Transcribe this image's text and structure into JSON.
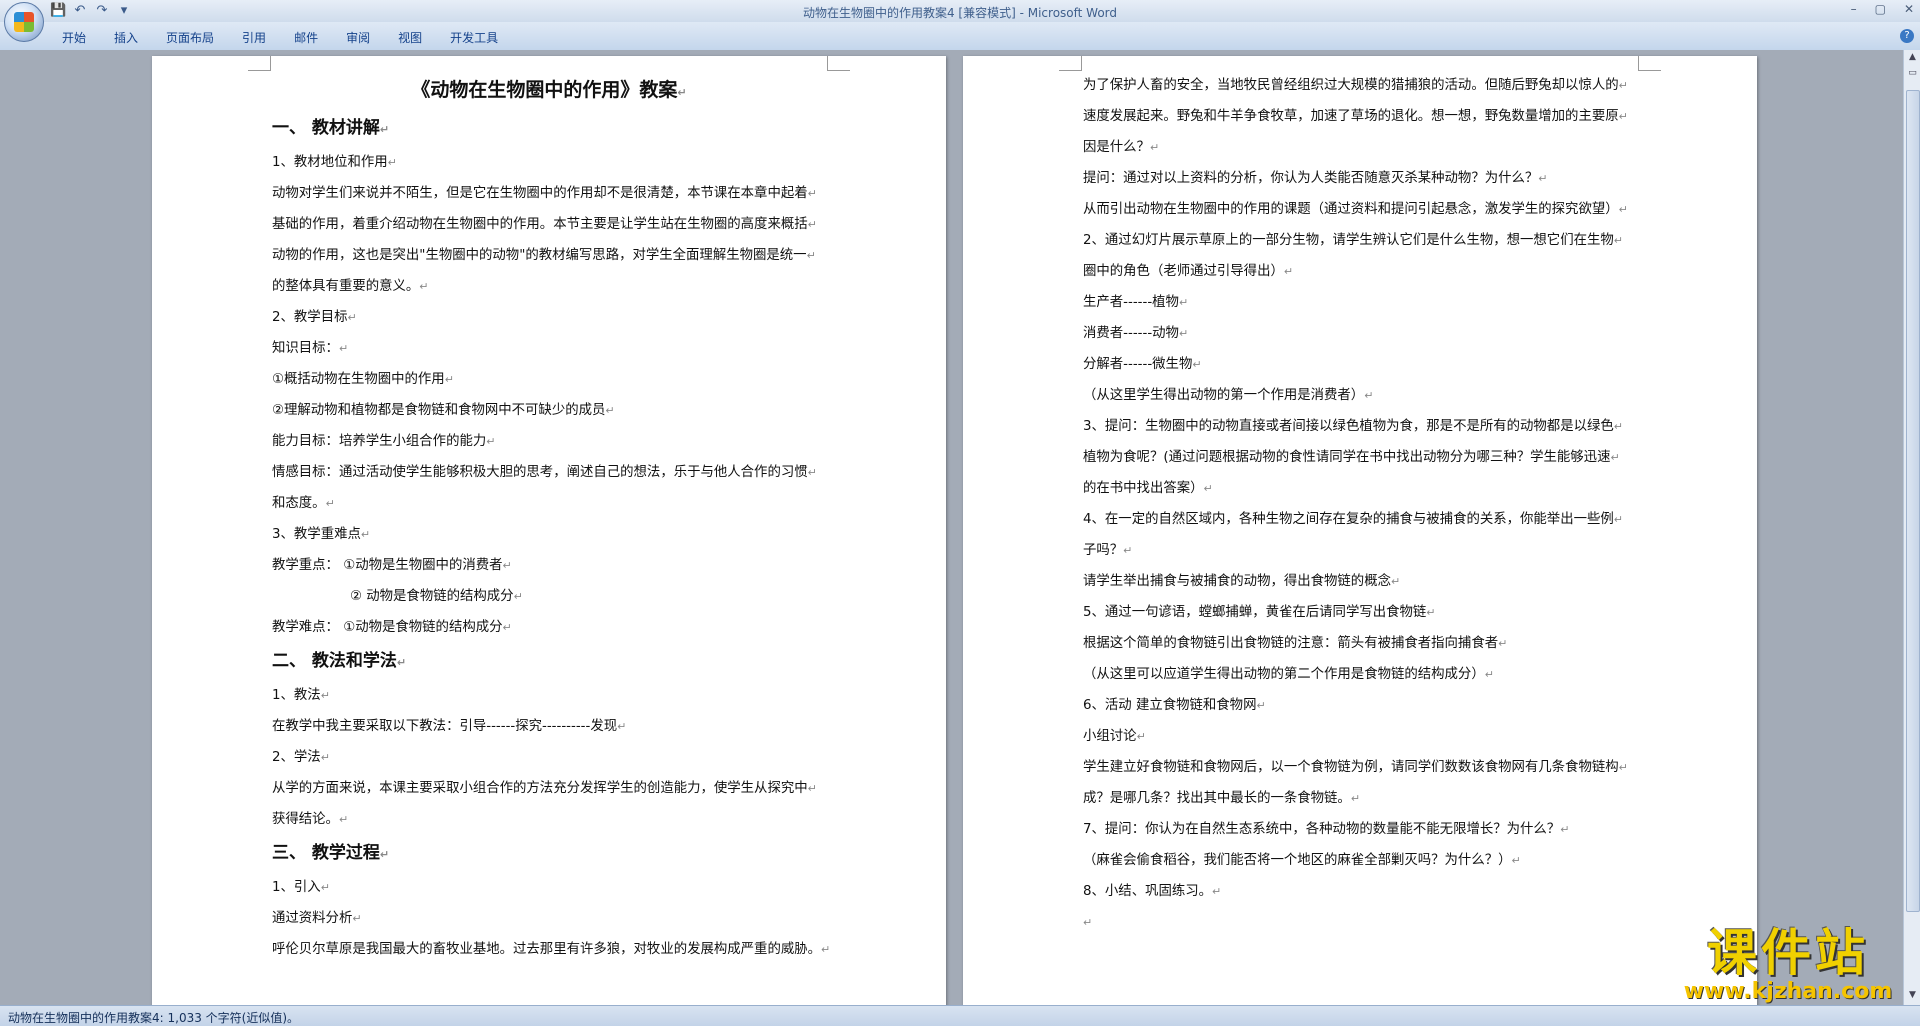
{
  "window": {
    "title": "动物在生物圈中的作用教案4 [兼容模式] - Microsoft Word",
    "controls": [
      "–",
      "▢",
      "✕"
    ]
  },
  "quick_access": {
    "icons": [
      "save-icon",
      "undo-icon",
      "redo-icon",
      "customize-icon"
    ],
    "glyphs": [
      "💾",
      "↶",
      "↷",
      "▾"
    ]
  },
  "ribbon": {
    "tabs": [
      "开始",
      "插入",
      "页面布局",
      "引用",
      "邮件",
      "审阅",
      "视图",
      "开发工具"
    ],
    "help": "?"
  },
  "page1": {
    "lines": [
      {
        "text": "《动物在生物圈中的作用》教案",
        "style": "h1"
      },
      {
        "text": "一、    教材讲解",
        "style": "h2"
      },
      {
        "text": "1、教材地位和作用",
        "style": ""
      },
      {
        "text": "动物对学生们来说并不陌生，但是它在生物圈中的作用却不是很清楚，本节课在本章中起着",
        "style": ""
      },
      {
        "text": "基础的作用，着重介绍动物在生物圈中的作用。本节主要是让学生站在生物圈的高度来概括",
        "style": ""
      },
      {
        "text": "动物的作用，这也是突出\"生物圈中的动物\"的教材编写思路，对学生全面理解生物圈是统一",
        "style": ""
      },
      {
        "text": "的整体具有重要的意义。",
        "style": ""
      },
      {
        "text": "2、教学目标",
        "style": ""
      },
      {
        "text": "知识目标：",
        "style": ""
      },
      {
        "text": "①概括动物在生物圈中的作用",
        "style": ""
      },
      {
        "text": "②理解动物和植物都是食物链和食物网中不可缺少的成员",
        "style": ""
      },
      {
        "text": "能力目标：培养学生小组合作的能力",
        "style": ""
      },
      {
        "text": "情感目标：通过活动使学生能够积极大胆的思考，阐述自己的想法，乐于与他人合作的习惯",
        "style": ""
      },
      {
        "text": "和态度。",
        "style": ""
      },
      {
        "text": "3、教学重难点",
        "style": ""
      },
      {
        "text": "教学重点：  ①动物是生物圈中的消费者",
        "style": ""
      },
      {
        "text": "② 动物是食物链的结构成分",
        "style": "ind"
      },
      {
        "text": "教学难点：  ①动物是食物链的结构成分",
        "style": ""
      },
      {
        "text": "二、    教法和学法",
        "style": "h2"
      },
      {
        "text": "1、教法",
        "style": ""
      },
      {
        "text": "在教学中我主要采取以下教法：引导------探究----------发现",
        "style": ""
      },
      {
        "text": "2、学法",
        "style": ""
      },
      {
        "text": "从学的方面来说，本课主要采取小组合作的方法充分发挥学生的创造能力，使学生从探究中",
        "style": ""
      },
      {
        "text": "获得结论。",
        "style": ""
      },
      {
        "text": "三、    教学过程",
        "style": "h2"
      },
      {
        "text": "1、引入",
        "style": ""
      },
      {
        "text": "通过资料分析",
        "style": ""
      },
      {
        "text": "呼伦贝尔草原是我国最大的畜牧业基地。过去那里有许多狼，对牧业的发展构成严重的威胁。",
        "style": ""
      }
    ]
  },
  "page2": {
    "lines": [
      {
        "text": "为了保护人畜的安全，当地牧民曾经组织过大规模的猎捕狼的活动。但随后野兔却以惊人的",
        "style": ""
      },
      {
        "text": "速度发展起来。野兔和牛羊争食牧草，加速了草场的退化。想一想，野兔数量增加的主要原",
        "style": ""
      },
      {
        "text": "因是什么？",
        "style": ""
      },
      {
        "text": "提问：通过对以上资料的分析，你认为人类能否随意灭杀某种动物？为什么？",
        "style": ""
      },
      {
        "text": "从而引出动物在生物圈中的作用的课题（通过资料和提问引起悬念，激发学生的探究欲望）",
        "style": ""
      },
      {
        "text": "2、通过幻灯片展示草原上的一部分生物，请学生辨认它们是什么生物，想一想它们在生物",
        "style": ""
      },
      {
        "text": "圈中的角色（老师通过引导得出）",
        "style": ""
      },
      {
        "text": "生产者------植物",
        "style": ""
      },
      {
        "text": "消费者------动物",
        "style": ""
      },
      {
        "text": "分解者------微生物",
        "style": ""
      },
      {
        "text": "（从这里学生得出动物的第一个作用是消费者）",
        "style": ""
      },
      {
        "text": "3、提问：生物圈中的动物直接或者间接以绿色植物为食，那是不是所有的动物都是以绿色",
        "style": ""
      },
      {
        "text": "植物为食呢？(通过问题根据动物的食性请同学在书中找出动物分为哪三种？学生能够迅速",
        "style": ""
      },
      {
        "text": "的在书中找出答案）",
        "style": ""
      },
      {
        "text": "4、在一定的自然区域内，各种生物之间存在复杂的捕食与被捕食的关系，你能举出一些例",
        "style": ""
      },
      {
        "text": "子吗？",
        "style": ""
      },
      {
        "text": "请学生举出捕食与被捕食的动物，得出食物链的概念",
        "style": ""
      },
      {
        "text": "5、通过一句谚语，螳螂捕蝉，黄雀在后请同学写出食物链",
        "style": ""
      },
      {
        "text": "根据这个简单的食物链引出食物链的注意：箭头有被捕食者指向捕食者",
        "style": ""
      },
      {
        "text": "（从这里可以应道学生得出动物的第二个作用是食物链的结构成分）",
        "style": ""
      },
      {
        "text": "6、活动    建立食物链和食物网",
        "style": ""
      },
      {
        "text": "小组讨论",
        "style": ""
      },
      {
        "text": "学生建立好食物链和食物网后，以一个食物链为例，请同学们数数该食物网有几条食物链构",
        "style": ""
      },
      {
        "text": "成？是哪几条？找出其中最长的一条食物链。",
        "style": ""
      },
      {
        "text": "7、提问：你认为在自然生态系统中，各种动物的数量能不能无限增长？为什么？",
        "style": ""
      },
      {
        "text": "（麻雀会偷食稻谷，我们能否将一个地区的麻雀全部剿灭吗？为什么？）",
        "style": ""
      },
      {
        "text": "8、小结、巩固练习。",
        "style": ""
      },
      {
        "text": "",
        "style": ""
      }
    ]
  },
  "paragraph_mark": "↵",
  "status": {
    "text": "动物在生物圈中的作用教案4: 1,033 个字符(近似值)。"
  },
  "watermark": {
    "main": "课件站",
    "sub": "www.kjzhan.com"
  }
}
